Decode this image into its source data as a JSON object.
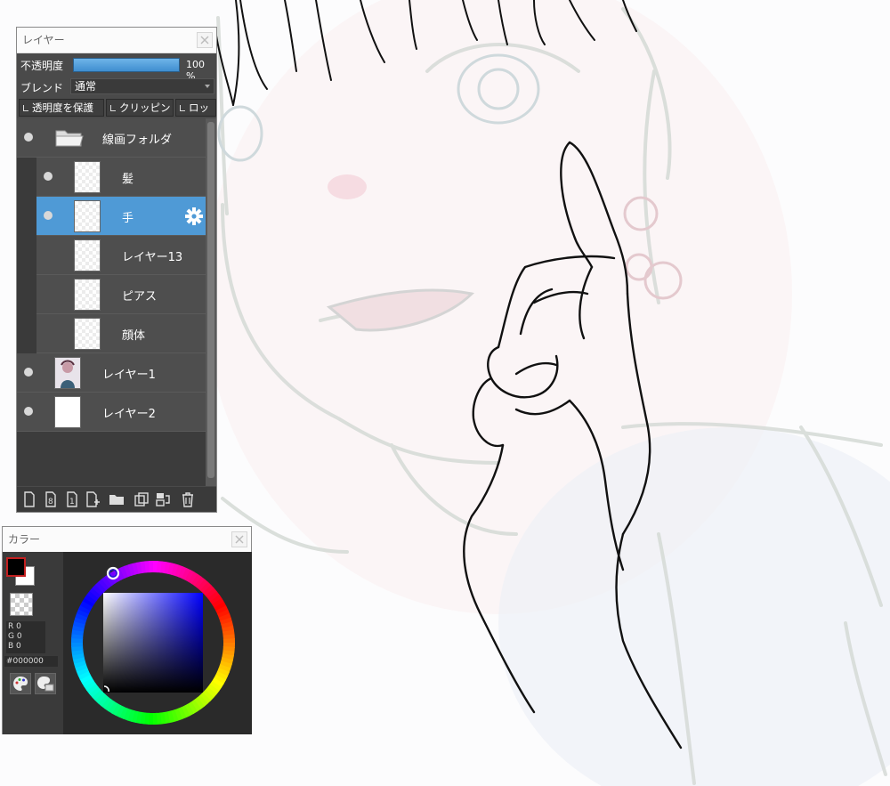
{
  "layer_panel": {
    "title": "レイヤー",
    "opacity_label": "不透明度",
    "opacity_value": "100 %",
    "blend_label": "ブレンド",
    "blend_value": "通常",
    "protect_alpha_label": "透明度を保護",
    "clipping_label": "クリッピング",
    "lock_label": "ロック",
    "layers": [
      {
        "name": "線画フォルダ",
        "type": "folder",
        "visible": true
      },
      {
        "name": "髪",
        "visible": true
      },
      {
        "name": "手",
        "visible": true,
        "selected": true
      },
      {
        "name": "レイヤー13",
        "visible": false
      },
      {
        "name": "ピアス",
        "visible": false
      },
      {
        "name": "顔体",
        "visible": false
      },
      {
        "name": "レイヤー1",
        "visible": true
      },
      {
        "name": "レイヤー2",
        "visible": true
      }
    ],
    "toolbar_icons": [
      "new-layer-icon",
      "new-8bit-layer-icon",
      "new-1bit-layer-icon",
      "add-layer-menu-icon",
      "new-folder-icon",
      "duplicate-layer-icon",
      "merge-layer-icon",
      "delete-layer-icon"
    ]
  },
  "color_panel": {
    "title": "カラー",
    "rgb_r": "R 0",
    "rgb_g": "G 0",
    "rgb_b": "B 0",
    "hex": "#000000",
    "foreground_color": "#000000",
    "background_color": "#ffffff"
  },
  "colors": {
    "panel_bg": "#4a4a4a",
    "selected_layer": "#4f9ad6",
    "opacity_bar": "#5aa5e0"
  }
}
